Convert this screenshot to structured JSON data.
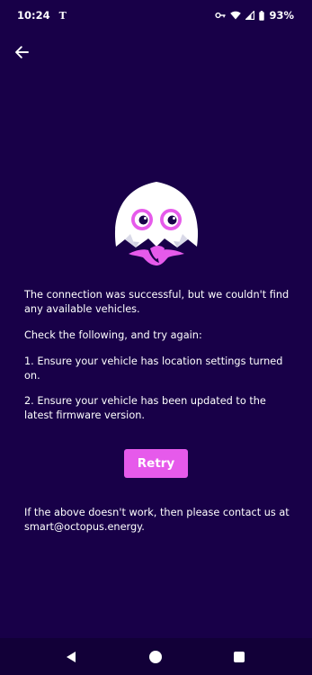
{
  "status_bar": {
    "time": "10:24",
    "carrier_glyph": "T",
    "battery": "93%",
    "icons": [
      "vpn-key-icon",
      "wifi-icon",
      "signal-icon",
      "battery-icon"
    ]
  },
  "header": {
    "back_icon": "arrow-left-icon"
  },
  "illustration": {
    "name": "ghost-mascot",
    "colors": {
      "body": "#ffffff",
      "shadow": "#d6d6e6",
      "eye_ring": "#e65aeb",
      "pupil": "#180048",
      "tentacles": "#e65aeb"
    }
  },
  "message": {
    "intro": "The connection was successful, but we couldn't find any available vehicles.",
    "check": "Check the following, and try again:",
    "step1": "1. Ensure your vehicle has location settings turned on.",
    "step2": "2. Ensure your vehicle has been updated to the latest firmware version."
  },
  "actions": {
    "retry_label": "Retry"
  },
  "footer": {
    "contact": "If the above doesn't work, then please contact us at smart@octopus.energy."
  },
  "nav_bar": {
    "back": "nav-back-icon",
    "home": "nav-home-icon",
    "recents": "nav-recents-icon"
  },
  "colors": {
    "background": "#180048",
    "accent": "#e65aeb",
    "text": "#ffffff",
    "nav_background": "#120038"
  }
}
